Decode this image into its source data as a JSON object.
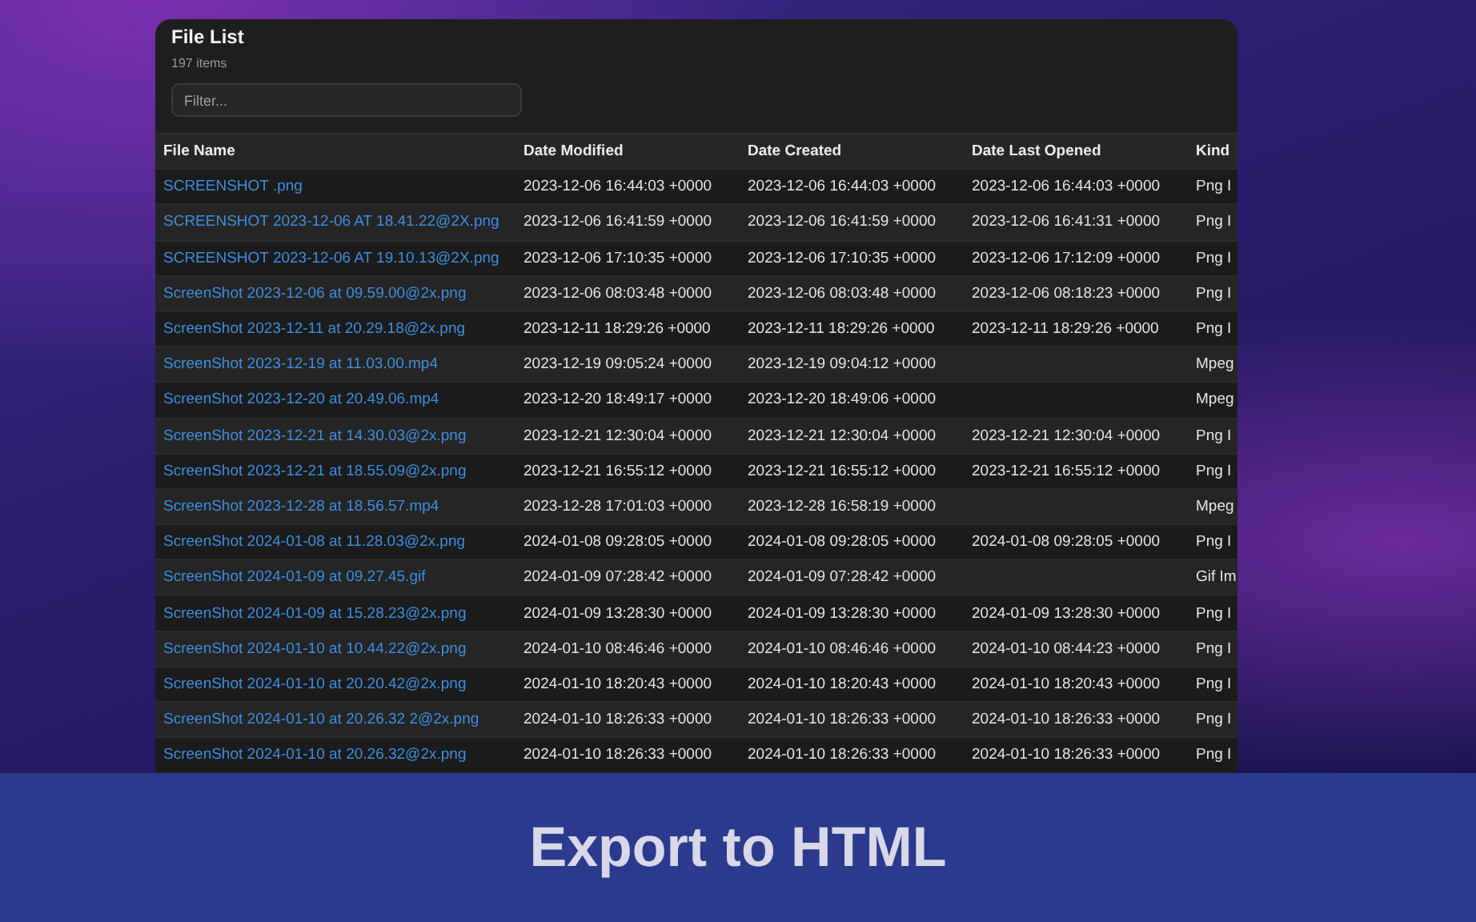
{
  "window": {
    "title": "File List",
    "count": "197 items"
  },
  "filter": {
    "placeholder": "Filter..."
  },
  "table": {
    "columns": [
      "File Name",
      "Date Modified",
      "Date Created",
      "Date Last Opened",
      "Kind"
    ],
    "rows": [
      [
        "SCREENSHOT .png",
        "2023-12-06 16:44:03 +0000",
        "2023-12-06 16:44:03 +0000",
        "2023-12-06 16:44:03 +0000",
        "Png I"
      ],
      [
        "SCREENSHOT 2023-12-06 AT 18.41.22@2X.png",
        "2023-12-06 16:41:59 +0000",
        "2023-12-06 16:41:59 +0000",
        "2023-12-06 16:41:31 +0000",
        "Png I"
      ],
      [
        "SCREENSHOT 2023-12-06 AT 19.10.13@2X.png",
        "2023-12-06 17:10:35 +0000",
        "2023-12-06 17:10:35 +0000",
        "2023-12-06 17:12:09 +0000",
        "Png I"
      ],
      [
        "ScreenShot 2023-12-06 at 09.59.00@2x.png",
        "2023-12-06 08:03:48 +0000",
        "2023-12-06 08:03:48 +0000",
        "2023-12-06 08:18:23 +0000",
        "Png I"
      ],
      [
        "ScreenShot 2023-12-11 at 20.29.18@2x.png",
        "2023-12-11 18:29:26 +0000",
        "2023-12-11 18:29:26 +0000",
        "2023-12-11 18:29:26 +0000",
        "Png I"
      ],
      [
        "ScreenShot 2023-12-19 at 11.03.00.mp4",
        "2023-12-19 09:05:24 +0000",
        "2023-12-19 09:04:12 +0000",
        "",
        "Mpeg"
      ],
      [
        "ScreenShot 2023-12-20 at 20.49.06.mp4",
        "2023-12-20 18:49:17 +0000",
        "2023-12-20 18:49:06 +0000",
        "",
        "Mpeg"
      ],
      [
        "ScreenShot 2023-12-21 at 14.30.03@2x.png",
        "2023-12-21 12:30:04 +0000",
        "2023-12-21 12:30:04 +0000",
        "2023-12-21 12:30:04 +0000",
        "Png I"
      ],
      [
        "ScreenShot 2023-12-21 at 18.55.09@2x.png",
        "2023-12-21 16:55:12 +0000",
        "2023-12-21 16:55:12 +0000",
        "2023-12-21 16:55:12 +0000",
        "Png I"
      ],
      [
        "ScreenShot 2023-12-28 at 18.56.57.mp4",
        "2023-12-28 17:01:03 +0000",
        "2023-12-28 16:58:19 +0000",
        "",
        "Mpeg"
      ],
      [
        "ScreenShot 2024-01-08 at 11.28.03@2x.png",
        "2024-01-08 09:28:05 +0000",
        "2024-01-08 09:28:05 +0000",
        "2024-01-08 09:28:05 +0000",
        "Png I"
      ],
      [
        "ScreenShot 2024-01-09 at 09.27.45.gif",
        "2024-01-09 07:28:42 +0000",
        "2024-01-09 07:28:42 +0000",
        "",
        "Gif Im"
      ],
      [
        "ScreenShot 2024-01-09 at 15.28.23@2x.png",
        "2024-01-09 13:28:30 +0000",
        "2024-01-09 13:28:30 +0000",
        "2024-01-09 13:28:30 +0000",
        "Png I"
      ],
      [
        "ScreenShot 2024-01-10 at 10.44.22@2x.png",
        "2024-01-10 08:46:46 +0000",
        "2024-01-10 08:46:46 +0000",
        "2024-01-10 08:44:23 +0000",
        "Png I"
      ],
      [
        "ScreenShot 2024-01-10 at 20.20.42@2x.png",
        "2024-01-10 18:20:43 +0000",
        "2024-01-10 18:20:43 +0000",
        "2024-01-10 18:20:43 +0000",
        "Png I"
      ],
      [
        "ScreenShot 2024-01-10 at 20.26.32 2@2x.png",
        "2024-01-10 18:26:33 +0000",
        "2024-01-10 18:26:33 +0000",
        "2024-01-10 18:26:33 +0000",
        "Png I"
      ],
      [
        "ScreenShot 2024-01-10 at 20.26.32@2x.png",
        "2024-01-10 18:26:33 +0000",
        "2024-01-10 18:26:33 +0000",
        "2024-01-10 18:26:33 +0000",
        "Png I"
      ]
    ]
  },
  "banner": {
    "title": "Export to HTML"
  }
}
